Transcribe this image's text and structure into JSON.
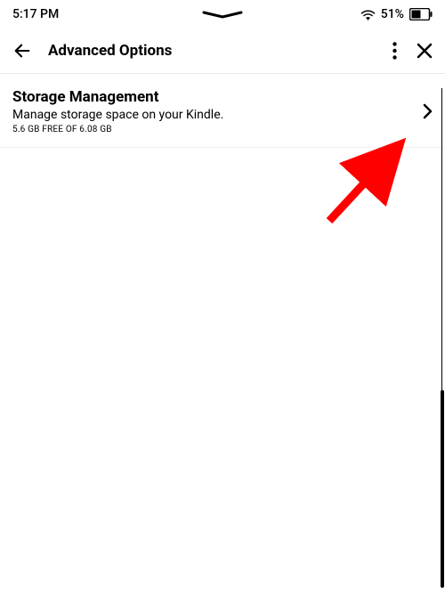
{
  "status": {
    "time": "5:17 PM",
    "battery_pct": "51%"
  },
  "header": {
    "title": "Advanced Options"
  },
  "items": [
    {
      "title": "Storage Management",
      "description": "Manage storage space on your Kindle.",
      "subtext": "5.6 GB FREE OF 6.08 GB"
    }
  ]
}
